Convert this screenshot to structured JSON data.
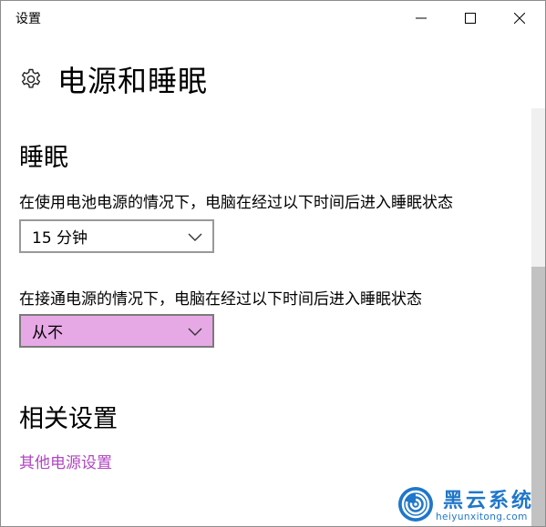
{
  "window": {
    "title": "设置"
  },
  "page": {
    "title": "电源和睡眠",
    "icon": "gear-icon"
  },
  "sleep": {
    "heading": "睡眠",
    "battery_label": "在使用电池电源的情况下，电脑在经过以下时间后进入睡眠状态",
    "battery_value": "15 分钟",
    "plugged_label": "在接通电源的情况下，电脑在经过以下时间后进入睡眠状态",
    "plugged_value": "从不"
  },
  "related": {
    "heading": "相关设置",
    "link_label": "其他电源设置"
  },
  "watermark": {
    "brand": "黑云系统",
    "url": "heiyunxitong.com"
  },
  "colors": {
    "link": "#b146c2",
    "selected_dropdown": "#e7a9e5",
    "watermark": "#1f77c9"
  }
}
